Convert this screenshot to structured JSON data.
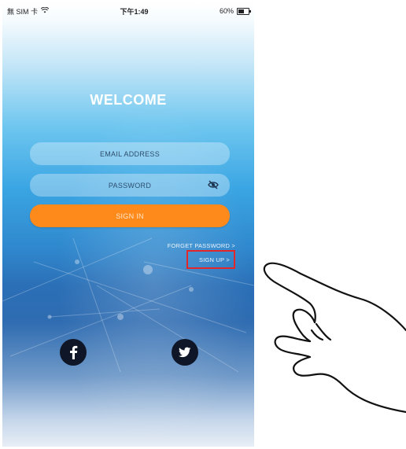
{
  "status_bar": {
    "carrier": "無 SIM 卡",
    "time": "下午1:49",
    "battery_text": "60%",
    "battery_level": 0.6,
    "wifi_icon": "wifi-icon"
  },
  "welcome": "WELCOME",
  "email": {
    "placeholder": "EMAIL  ADDRESS"
  },
  "password": {
    "placeholder": "PASSWORD",
    "toggle_icon": "eye-slash-icon"
  },
  "signin_label": "SIGN IN",
  "forget_label": "FORGET PASSWORD >",
  "signup_label": "SIGN UP >",
  "social": {
    "facebook_icon": "facebook-icon",
    "twitter_icon": "twitter-icon"
  },
  "colors": {
    "signin": "#ff8a1c",
    "highlight": "#e3262a",
    "social_bg": "#0f1628"
  }
}
